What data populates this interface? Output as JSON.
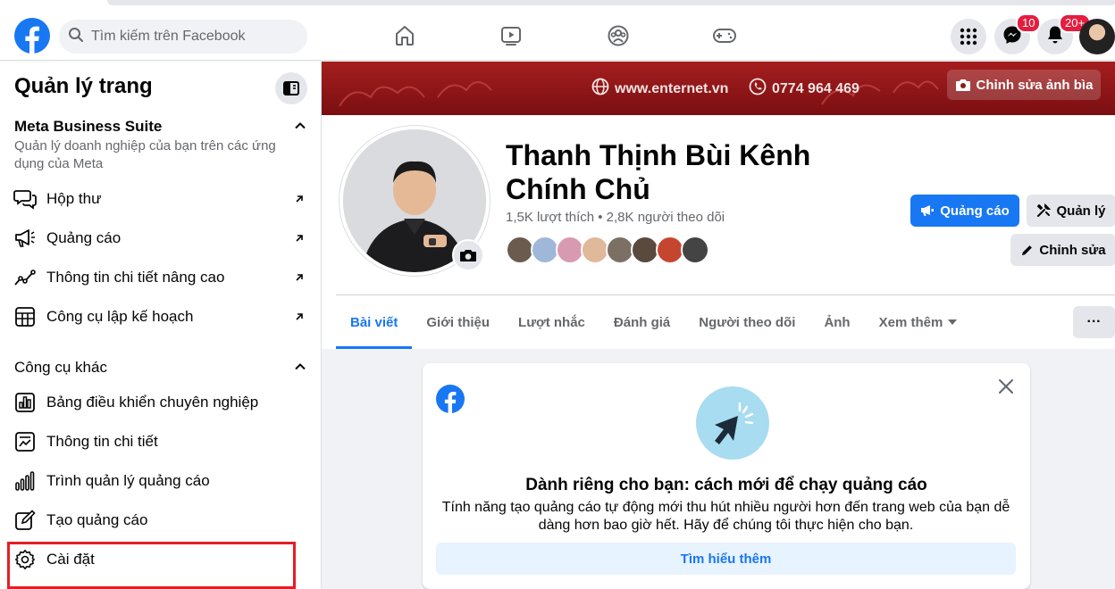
{
  "header": {
    "search_placeholder": "Tìm kiếm trên Facebook",
    "messenger_badge": "10",
    "notifications_badge": "20+"
  },
  "sidebar": {
    "title": "Quản lý trang",
    "meta_section": {
      "heading": "Meta Business Suite",
      "subtitle": "Quản lý doanh nghiệp của bạn trên các ứng dụng của Meta",
      "items": [
        {
          "label": "Hộp thư",
          "icon": "inbox-icon"
        },
        {
          "label": "Quảng cáo",
          "icon": "megaphone-icon"
        },
        {
          "label": "Thông tin chi tiết nâng cao",
          "icon": "insights-icon"
        },
        {
          "label": "Công cụ lập kế hoạch",
          "icon": "planner-icon"
        }
      ]
    },
    "other_section": {
      "heading": "Công cụ khác",
      "items": [
        {
          "label": "Bảng điều khiển chuyên nghiệp",
          "icon": "dashboard-icon"
        },
        {
          "label": "Thông tin chi tiết",
          "icon": "details-icon"
        },
        {
          "label": "Trình quản lý quảng cáo",
          "icon": "ads-manager-icon"
        },
        {
          "label": "Tạo quảng cáo",
          "icon": "create-ad-icon"
        },
        {
          "label": "Cài đặt",
          "icon": "gear-icon"
        }
      ]
    }
  },
  "cover": {
    "website": "www.enternet.vn",
    "phone": "0774 964 469",
    "edit_label": "Chỉnh sửa ảnh bìa"
  },
  "page": {
    "name": "Thanh Thịnh Bùi Kênh Chính Chủ",
    "stats": "1,5K lượt thích • 2,8K người theo dõi",
    "buttons": {
      "ads": "Quảng cáo",
      "manage": "Quản lý",
      "edit": "Chỉnh sửa"
    },
    "tabs": [
      "Bài viết",
      "Giới thiệu",
      "Lượt nhắc",
      "Đánh giá",
      "Người theo dõi",
      "Ảnh",
      "Xem thêm"
    ],
    "more_label": "···"
  },
  "promo": {
    "title": "Dành riêng cho bạn: cách mới để chạy quảng cáo",
    "description": "Tính năng tạo quảng cáo tự động mới thu hút nhiều người hơn đến trang web của bạn dễ dàng hơn bao giờ hết. Hãy để chúng tôi thực hiện cho bạn.",
    "button": "Tìm hiểu thêm"
  },
  "colors": {
    "brand": "#1877f2",
    "highlight": "#e41e23",
    "badge": "#e41e3f"
  }
}
